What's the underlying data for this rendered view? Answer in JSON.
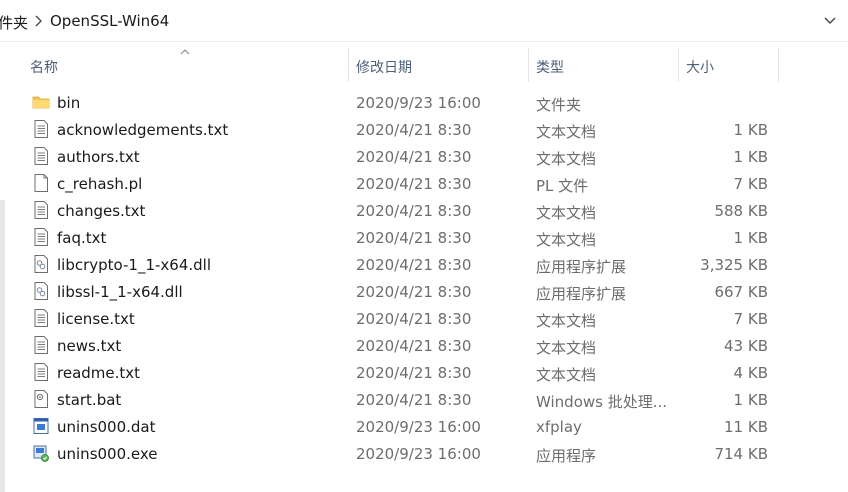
{
  "breadcrumb": {
    "parent": "件夹",
    "current": "OpenSSL-Win64"
  },
  "columns": {
    "name": "名称",
    "date": "修改日期",
    "type": "类型",
    "size": "大小"
  },
  "files": [
    {
      "name": "bin",
      "date": "2020/9/23 16:00",
      "type": "文件夹",
      "size": "",
      "icon": "folder-icon"
    },
    {
      "name": "acknowledgements.txt",
      "date": "2020/4/21 8:30",
      "type": "文本文档",
      "size": "1 KB",
      "icon": "text-file-icon"
    },
    {
      "name": "authors.txt",
      "date": "2020/4/21 8:30",
      "type": "文本文档",
      "size": "1 KB",
      "icon": "text-file-icon"
    },
    {
      "name": "c_rehash.pl",
      "date": "2020/4/21 8:30",
      "type": "PL 文件",
      "size": "7 KB",
      "icon": "blank-file-icon"
    },
    {
      "name": "changes.txt",
      "date": "2020/4/21 8:30",
      "type": "文本文档",
      "size": "588 KB",
      "icon": "text-file-icon"
    },
    {
      "name": "faq.txt",
      "date": "2020/4/21 8:30",
      "type": "文本文档",
      "size": "1 KB",
      "icon": "text-file-icon"
    },
    {
      "name": "libcrypto-1_1-x64.dll",
      "date": "2020/4/21 8:30",
      "type": "应用程序扩展",
      "size": "3,325 KB",
      "icon": "dll-file-icon"
    },
    {
      "name": "libssl-1_1-x64.dll",
      "date": "2020/4/21 8:30",
      "type": "应用程序扩展",
      "size": "667 KB",
      "icon": "dll-file-icon"
    },
    {
      "name": "license.txt",
      "date": "2020/4/21 8:30",
      "type": "文本文档",
      "size": "7 KB",
      "icon": "text-file-icon"
    },
    {
      "name": "news.txt",
      "date": "2020/4/21 8:30",
      "type": "文本文档",
      "size": "43 KB",
      "icon": "text-file-icon"
    },
    {
      "name": "readme.txt",
      "date": "2020/4/21 8:30",
      "type": "文本文档",
      "size": "4 KB",
      "icon": "text-file-icon"
    },
    {
      "name": "start.bat",
      "date": "2020/4/21 8:30",
      "type": "Windows 批处理...",
      "size": "1 KB",
      "icon": "bat-file-icon"
    },
    {
      "name": "unins000.dat",
      "date": "2020/9/23 16:00",
      "type": "xfplay",
      "size": "11 KB",
      "icon": "dat-file-icon"
    },
    {
      "name": "unins000.exe",
      "date": "2020/9/23 16:00",
      "type": "应用程序",
      "size": "714 KB",
      "icon": "installer-icon"
    }
  ]
}
